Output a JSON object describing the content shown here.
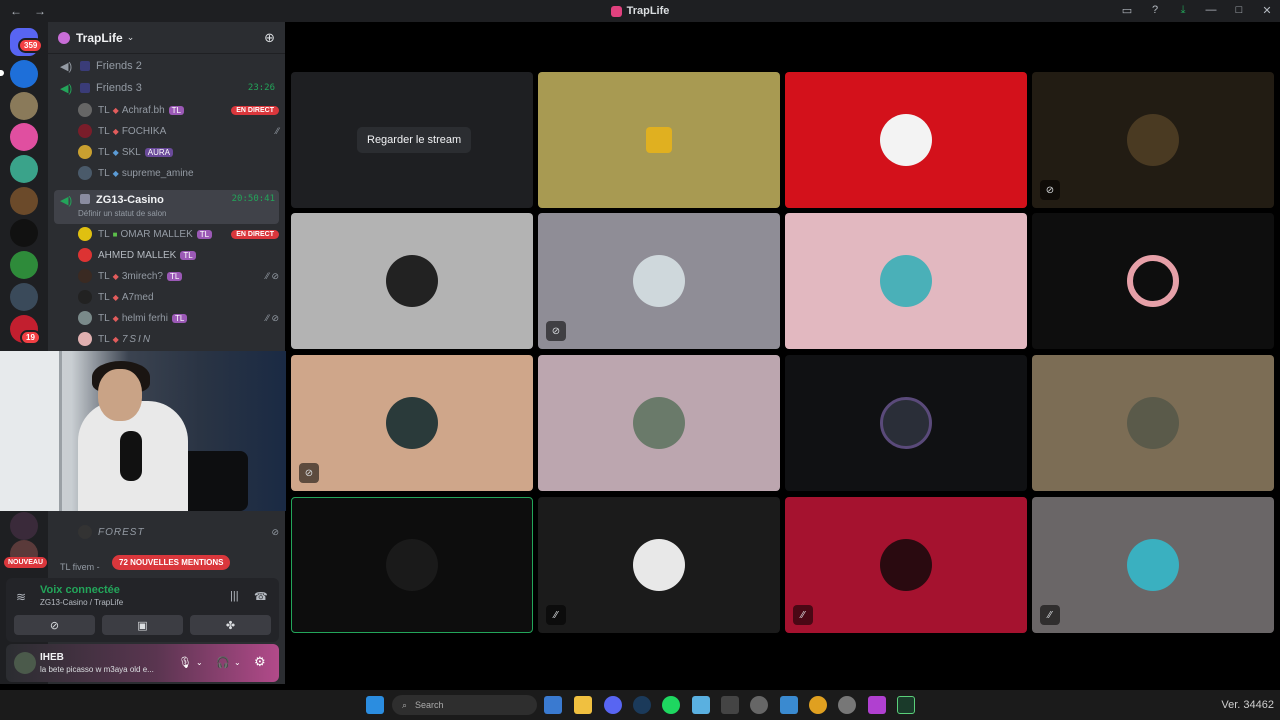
{
  "window": {
    "title": "TrapLife"
  },
  "rail": {
    "home_badge": "359",
    "server_badge": "19"
  },
  "server": {
    "name": "TrapLife"
  },
  "channels": [
    {
      "name": "Friends 2",
      "time": ""
    },
    {
      "name": "Friends 3",
      "time": "23:26"
    }
  ],
  "friends3_users": [
    {
      "tl": "TL",
      "name": "Achraf.bh",
      "tag": "TL",
      "live": "EN DIRECT"
    },
    {
      "tl": "TL",
      "name": "FOCHIKA",
      "tag": "",
      "live": ""
    },
    {
      "tl": "TL",
      "name": "SKL",
      "tag": "AURA",
      "live": ""
    },
    {
      "tl": "TL",
      "name": "supreme_amine",
      "tag": "",
      "live": ""
    }
  ],
  "active_channel": {
    "name": "ZG13-Casino",
    "time": "20:50:41",
    "subtitle": "Définir un statut de salon"
  },
  "casino_users": [
    {
      "tl": "TL",
      "name": "OMAR MALLEK",
      "tag": "TL",
      "live": "EN DIRECT"
    },
    {
      "tl": "",
      "name": "AHMED MALLEK",
      "tag": "TL",
      "live": ""
    },
    {
      "tl": "TL",
      "name": "3mirech?",
      "tag": "TL",
      "live": ""
    },
    {
      "tl": "TL",
      "name": "A7med",
      "tag": "",
      "live": ""
    },
    {
      "tl": "TL",
      "name": "helmi ferhi",
      "tag": "TL",
      "live": ""
    },
    {
      "tl": "TL",
      "name": "7SIN",
      "tag": "",
      "live": ""
    }
  ],
  "below_cam_users": [
    {
      "name": "FOREST"
    }
  ],
  "notices": {
    "mentions": "72 NOUVELLES MENTIONS",
    "nouveau": "NOUVEAU",
    "fivem": "TL fivem -"
  },
  "voice_panel": {
    "status": "Voix connectée",
    "location": "ZG13-Casino / TrapLife"
  },
  "user_bar": {
    "name": "IHEB",
    "status": "la bete picasso w m3aya old e..."
  },
  "stage": {
    "stream_button": "Regarder le stream"
  },
  "taskbar": {
    "search_placeholder": "Search",
    "version": "Ver. 34462"
  },
  "tile_colors": [
    "#1e1f22",
    "#a89a52",
    "#d3111b",
    "#221c13",
    "#b3b3b3",
    "#8f8d96",
    "#e2b8c0",
    "#0e0e0e",
    "#cfa68a",
    "#bca6af",
    "#101113",
    "#7c6d55",
    "#0d0d0d",
    "#1b1b1b",
    "#a5122f",
    "#6a6667"
  ]
}
